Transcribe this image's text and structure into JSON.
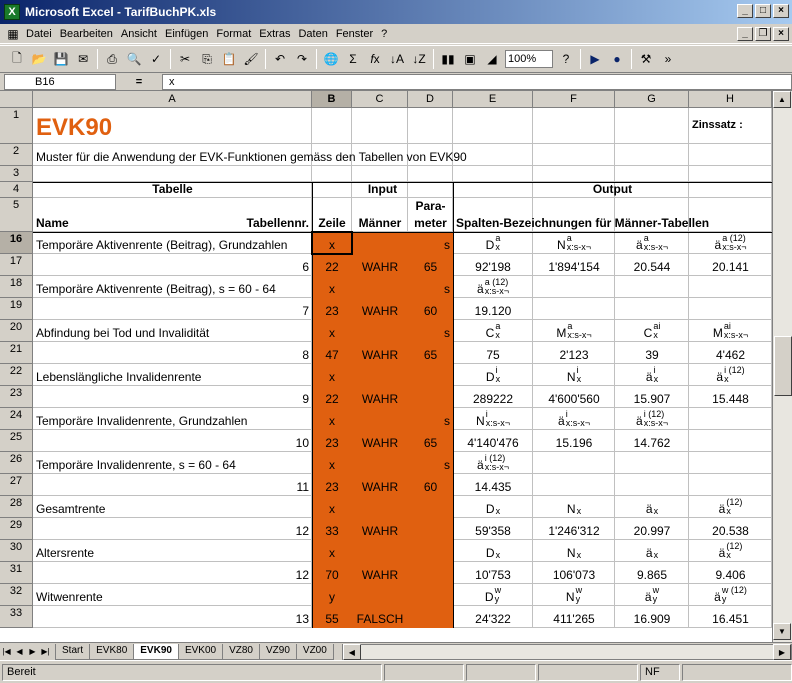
{
  "window": {
    "title": "Microsoft Excel - TarifBuchPK.xls"
  },
  "menu": [
    "Datei",
    "Bearbeiten",
    "Ansicht",
    "Einfügen",
    "Format",
    "Extras",
    "Daten",
    "Fenster",
    "?"
  ],
  "toolbar": {
    "zoom": "100%"
  },
  "formula_bar": {
    "name_box": "B16",
    "fx_label": "=",
    "content": "x"
  },
  "columns": [
    "A",
    "B",
    "C",
    "D",
    "E",
    "F",
    "G",
    "H"
  ],
  "rows": [
    "1",
    "2",
    "3",
    "4",
    "5",
    "16",
    "17",
    "18",
    "19",
    "20",
    "21",
    "22",
    "23",
    "24",
    "25",
    "26",
    "27",
    "28",
    "29",
    "30",
    "31",
    "32",
    "33"
  ],
  "sheet": {
    "title": "EVK90",
    "zinssatz_label": "Zinssatz :",
    "subtitle": "Muster für die Anwendung der EVK-Funktionen gemäss den Tabellen von EVK90",
    "group_tabelle": "Tabelle",
    "group_input": "Input",
    "group_output": "Output",
    "hdr_name": "Name",
    "hdr_tabellennr": "Tabellennr.",
    "hdr_zeile": "Zeile",
    "hdr_maenner": "Männer",
    "hdr_para": "Para-",
    "hdr_meter": "meter",
    "hdr_spalten": "Spalten-Bezeichnungen für Männer-Tabellen"
  },
  "records": [
    {
      "name": "Temporäre Aktivenrente (Beitrag), Grundzahlen",
      "nr": "6",
      "z1": "x",
      "z2": "22",
      "m": "WAHR",
      "p1": "s",
      "p2": "65",
      "labels": [
        "D^a_x",
        "N^a_x:s-x¬",
        "ä^a_x:s-x¬",
        "ä^a (12)_x:s-x¬"
      ],
      "values": [
        "92'198",
        "1'894'154",
        "20.544",
        "20.141"
      ]
    },
    {
      "name": "Temporäre Aktivenrente (Beitrag), s = 60 - 64",
      "nr": "7",
      "z1": "x",
      "z2": "23",
      "m": "WAHR",
      "p1": "s",
      "p2": "60",
      "labels": [
        "ä^a (12)_x:s-x¬"
      ],
      "values": [
        "19.120"
      ]
    },
    {
      "name": "Abfindung bei Tod und Invalidität",
      "nr": "8",
      "z1": "x",
      "z2": "47",
      "m": "WAHR",
      "p1": "s",
      "p2": "65",
      "labels": [
        "C^a_x",
        "M^a_x:s-x¬",
        "C^ai_x",
        "M^ai_x:s-x¬"
      ],
      "values": [
        "75",
        "2'123",
        "39",
        "4'462"
      ]
    },
    {
      "name": "Lebenslängliche Invalidenrente",
      "nr": "9",
      "z1": "x",
      "z2": "22",
      "m": "WAHR",
      "p1": "",
      "p2": "",
      "labels": [
        "D^i_x",
        "N^i_x",
        "ä^i_x",
        "ä^i (12)_x"
      ],
      "values": [
        "289222",
        "4'600'560",
        "15.907",
        "15.448"
      ]
    },
    {
      "name": "Temporäre Invalidenrente, Grundzahlen",
      "nr": "10",
      "z1": "x",
      "z2": "23",
      "m": "WAHR",
      "p1": "s",
      "p2": "65",
      "labels": [
        "N^i_x:s-x¬",
        "ä^i_x:s-x¬",
        "ä^i (12)_x:s-x¬"
      ],
      "values": [
        "4'140'476",
        "15.196",
        "14.762"
      ]
    },
    {
      "name": "Temporäre Invalidenrente, s = 60 - 64",
      "nr": "11",
      "z1": "x",
      "z2": "23",
      "m": "WAHR",
      "p1": "s",
      "p2": "60",
      "labels": [
        "ä^i (12)_x:s-x¬"
      ],
      "values": [
        "14.435"
      ]
    },
    {
      "name": "Gesamtrente",
      "nr": "12",
      "z1": "x",
      "z2": "33",
      "m": "WAHR",
      "p1": "",
      "p2": "",
      "labels": [
        "D_x",
        "N_x",
        "ä_x",
        "ä^(12)_x"
      ],
      "values": [
        "59'358",
        "1'246'312",
        "20.997",
        "20.538"
      ]
    },
    {
      "name": "Altersrente",
      "nr": "12",
      "z1": "x",
      "z2": "70",
      "m": "WAHR",
      "p1": "",
      "p2": "",
      "labels": [
        "D_x",
        "N_x",
        "ä_x",
        "ä^(12)_x"
      ],
      "values": [
        "10'753",
        "106'073",
        "9.865",
        "9.406"
      ]
    },
    {
      "name": "Witwenrente",
      "nr": "13",
      "z1": "y",
      "z2": "55",
      "m": "FALSCH",
      "p1": "",
      "p2": "",
      "labels": [
        "D^w_y",
        "N^w_y",
        "ä^w_y",
        "ä^w (12)_y"
      ],
      "values": [
        "24'322",
        "411'265",
        "16.909",
        "16.451"
      ]
    }
  ],
  "sheet_tabs": [
    "Start",
    "EVK80",
    "EVK90",
    "EVK00",
    "VZ80",
    "VZ90",
    "VZ00"
  ],
  "active_tab": "EVK90",
  "status": {
    "ready": "Bereit",
    "nf": "NF"
  },
  "colors": {
    "accent": "#e06010",
    "title_text": "#e06010"
  }
}
